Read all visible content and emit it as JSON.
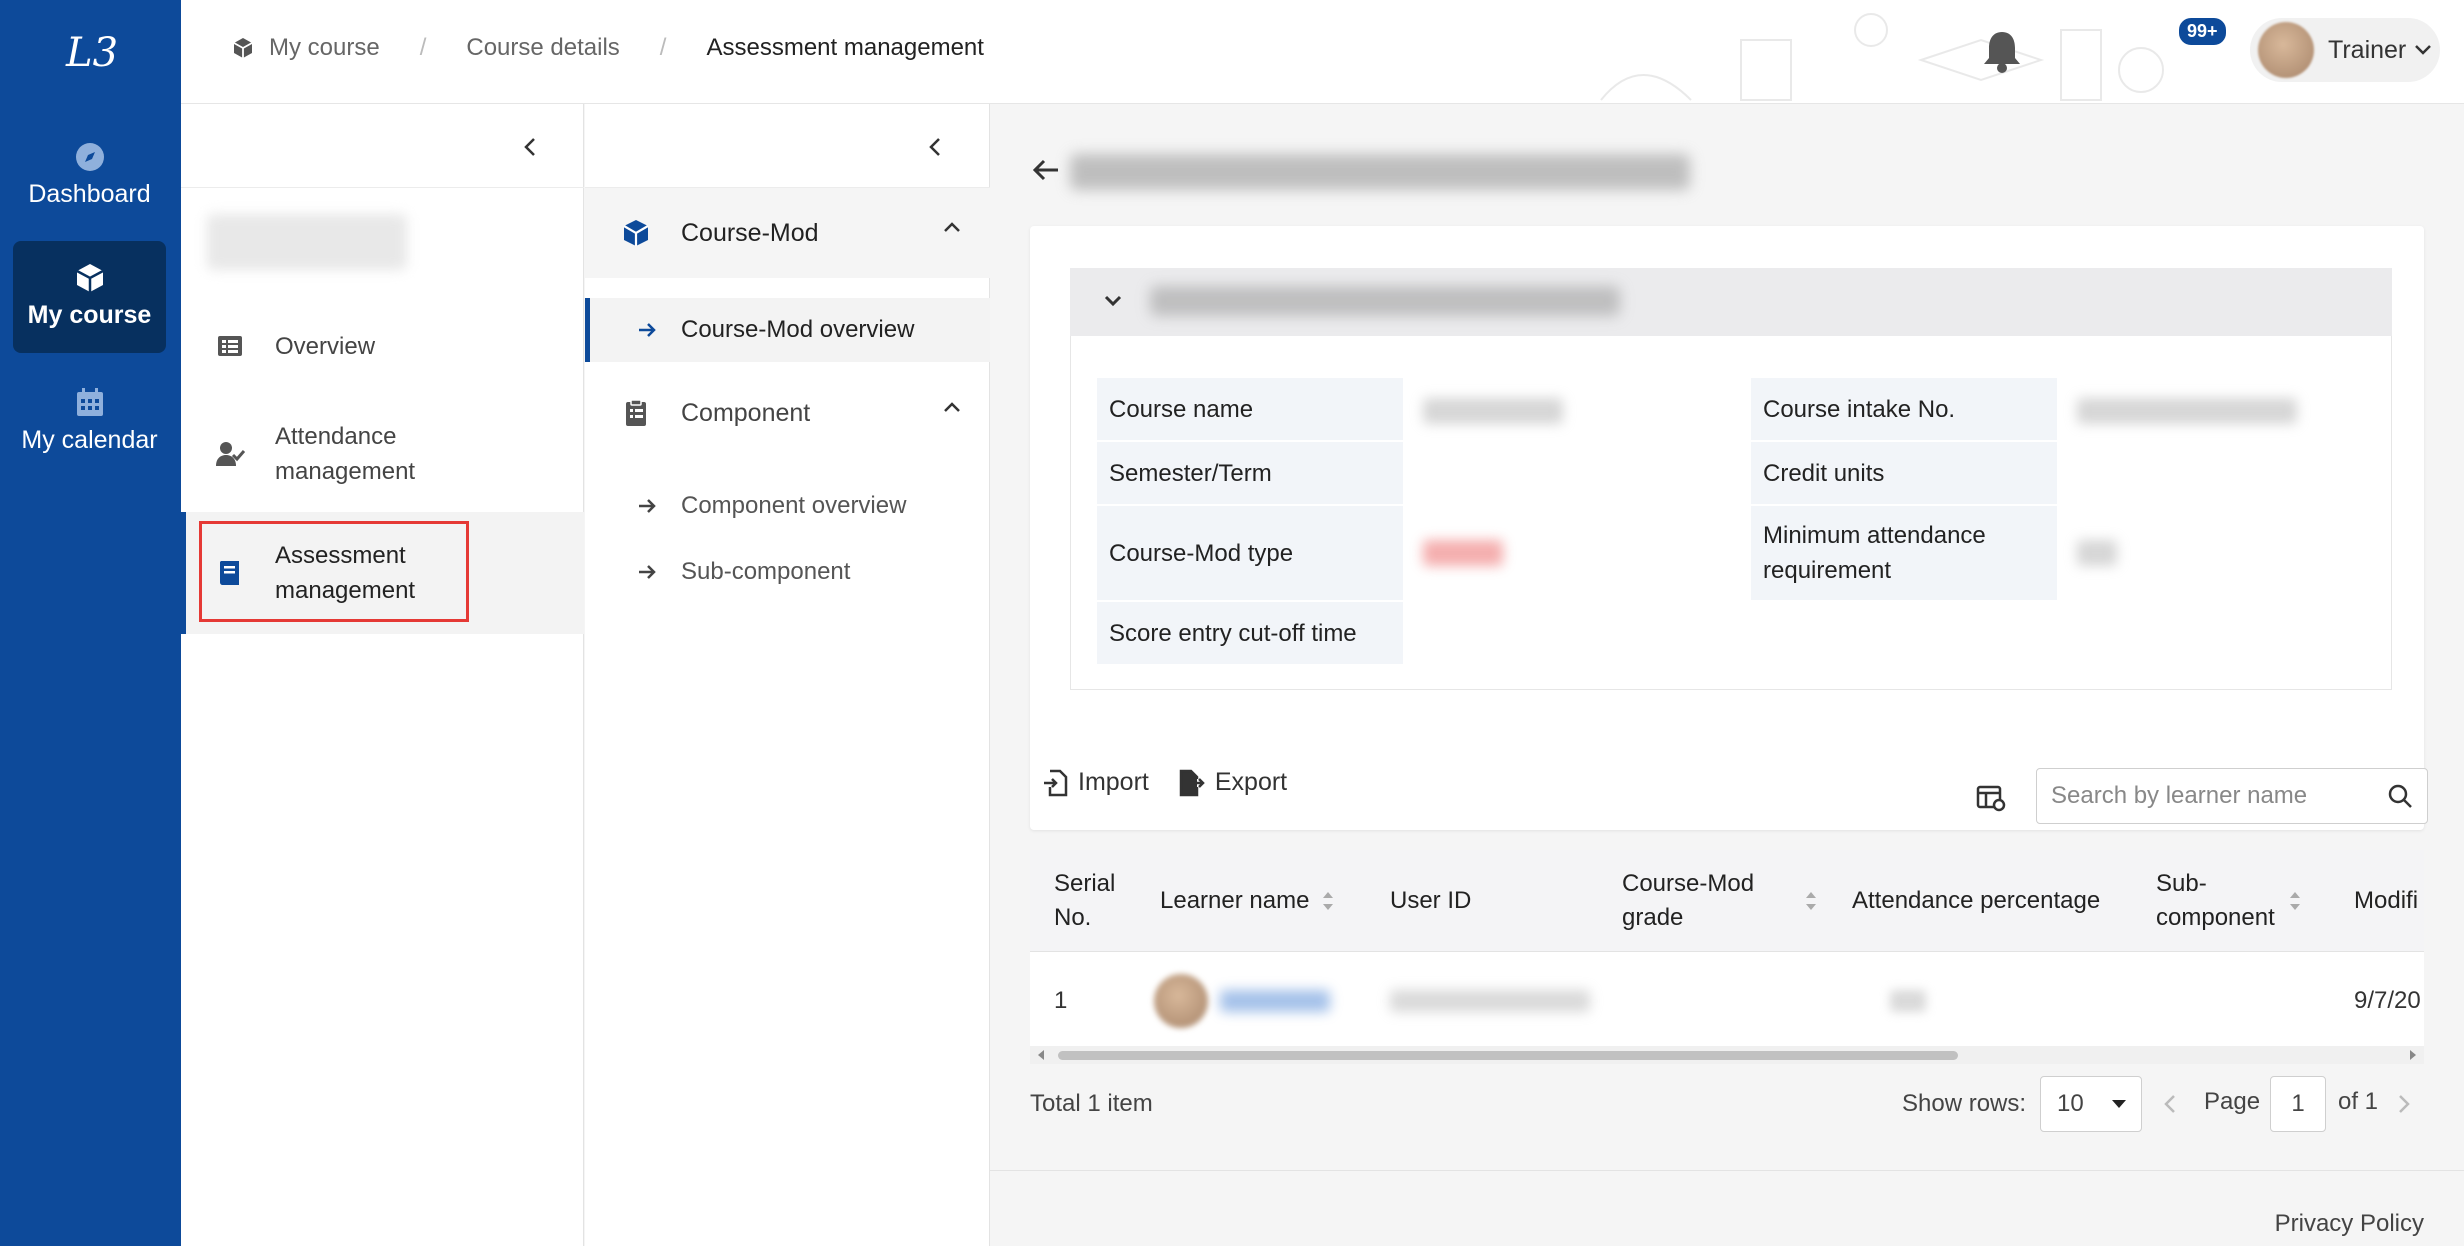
{
  "nav": {
    "logo_text": "L3",
    "items": [
      {
        "label": "Dashboard",
        "icon": "compass-icon",
        "active": false
      },
      {
        "label": "My course",
        "icon": "cube-icon",
        "active": true
      },
      {
        "label": "My calendar",
        "icon": "calendar-icon",
        "active": false
      }
    ]
  },
  "breadcrumb": {
    "items": [
      "My course",
      "Course details",
      "Assessment management"
    ],
    "separator": "/"
  },
  "header": {
    "notification_badge": "99+",
    "user_name": "Trainer"
  },
  "course_menu": {
    "items": [
      {
        "label": "Overview",
        "icon": "list-icon"
      },
      {
        "label": "Attendance management",
        "icon": "user-check-icon"
      },
      {
        "label": "Assessment management",
        "icon": "book-icon",
        "active": true
      }
    ]
  },
  "module_menu": {
    "groups": [
      {
        "label": "Course-Mod",
        "icon": "cube-icon",
        "children": [
          "Course-Mod overview"
        ]
      },
      {
        "label": "Component",
        "icon": "clipboard-icon",
        "children": [
          "Component overview",
          "Sub-component"
        ]
      }
    ],
    "active_item": "Course-Mod overview"
  },
  "details": {
    "labels": {
      "course_name": "Course name",
      "course_intake_no": "Course intake No.",
      "semester_term": "Semester/Term",
      "credit_units": "Credit units",
      "course_mod_type": "Course-Mod type",
      "min_attendance": "Minimum attendance requirement",
      "score_cutoff": "Score entry cut-off time"
    }
  },
  "toolbar": {
    "import_label": "Import",
    "export_label": "Export",
    "search_placeholder": "Search by learner name"
  },
  "table": {
    "columns": [
      "Serial No.",
      "Learner name",
      "User ID",
      "Course-Mod grade",
      "Attendance percentage",
      "Sub-component",
      "Modifi"
    ],
    "rows": [
      {
        "serial": "1",
        "modified": "9/7/20"
      }
    ]
  },
  "pagination": {
    "total": "Total 1 item",
    "show_rows_label": "Show rows:",
    "rows_value": "10",
    "page_label": "Page",
    "page_value": "1",
    "of_label": "of 1"
  },
  "footer": {
    "privacy": "Privacy Policy"
  },
  "colors": {
    "nav_bg": "#0d4a9a",
    "nav_active": "#07305f",
    "highlight": "#e53935"
  }
}
